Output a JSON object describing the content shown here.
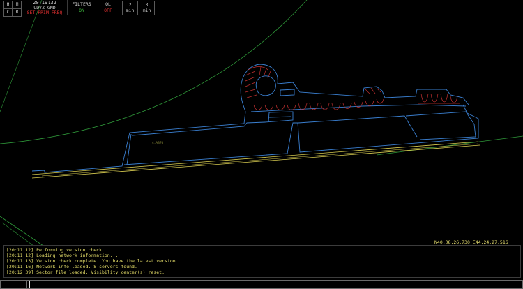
{
  "toolbar": {
    "buttons": [
      {
        "label": "H"
      },
      {
        "label": "M"
      },
      {
        "label": "C"
      },
      {
        "label": "R"
      }
    ],
    "clock": "20:19:32",
    "callsign": "UDYZ_GND",
    "prim_freq": "SET PRIM FREQ",
    "filters_label": "FILTERS",
    "filters_value": "ON",
    "ql_label": "QL",
    "ql_value": "OFF",
    "timers": [
      {
        "value": "2",
        "unit": "min"
      },
      {
        "value": "3",
        "unit": "min"
      }
    ]
  },
  "map": {
    "label": "4,AB70"
  },
  "status": {
    "coordinates": "N40.08.26.730 E44.24.27.516"
  },
  "log": {
    "messages": [
      {
        "time": "[20:11:12]",
        "text": "Performing version check..."
      },
      {
        "time": "[20:11:12]",
        "text": "Loading network information..."
      },
      {
        "time": "[20:11:13]",
        "text": "Version check complete. You have the latest version."
      },
      {
        "time": "[20:11:16]",
        "text": "Network info loaded. 8 servers found."
      },
      {
        "time": "[20:12:39]",
        "text": "Sector file loaded. Visibility center(s) reset."
      }
    ]
  },
  "colors": {
    "toolbar_text": "#d0d0d0",
    "filters_on": "#40c040",
    "ql_off": "#e03030",
    "prim_freq": "#e03030",
    "log_text": "#e6df6a",
    "taxiway": "#3a7fd0",
    "runway": "#d8cc50",
    "stands": "#c03030",
    "sector_line": "#2f9a3a"
  }
}
